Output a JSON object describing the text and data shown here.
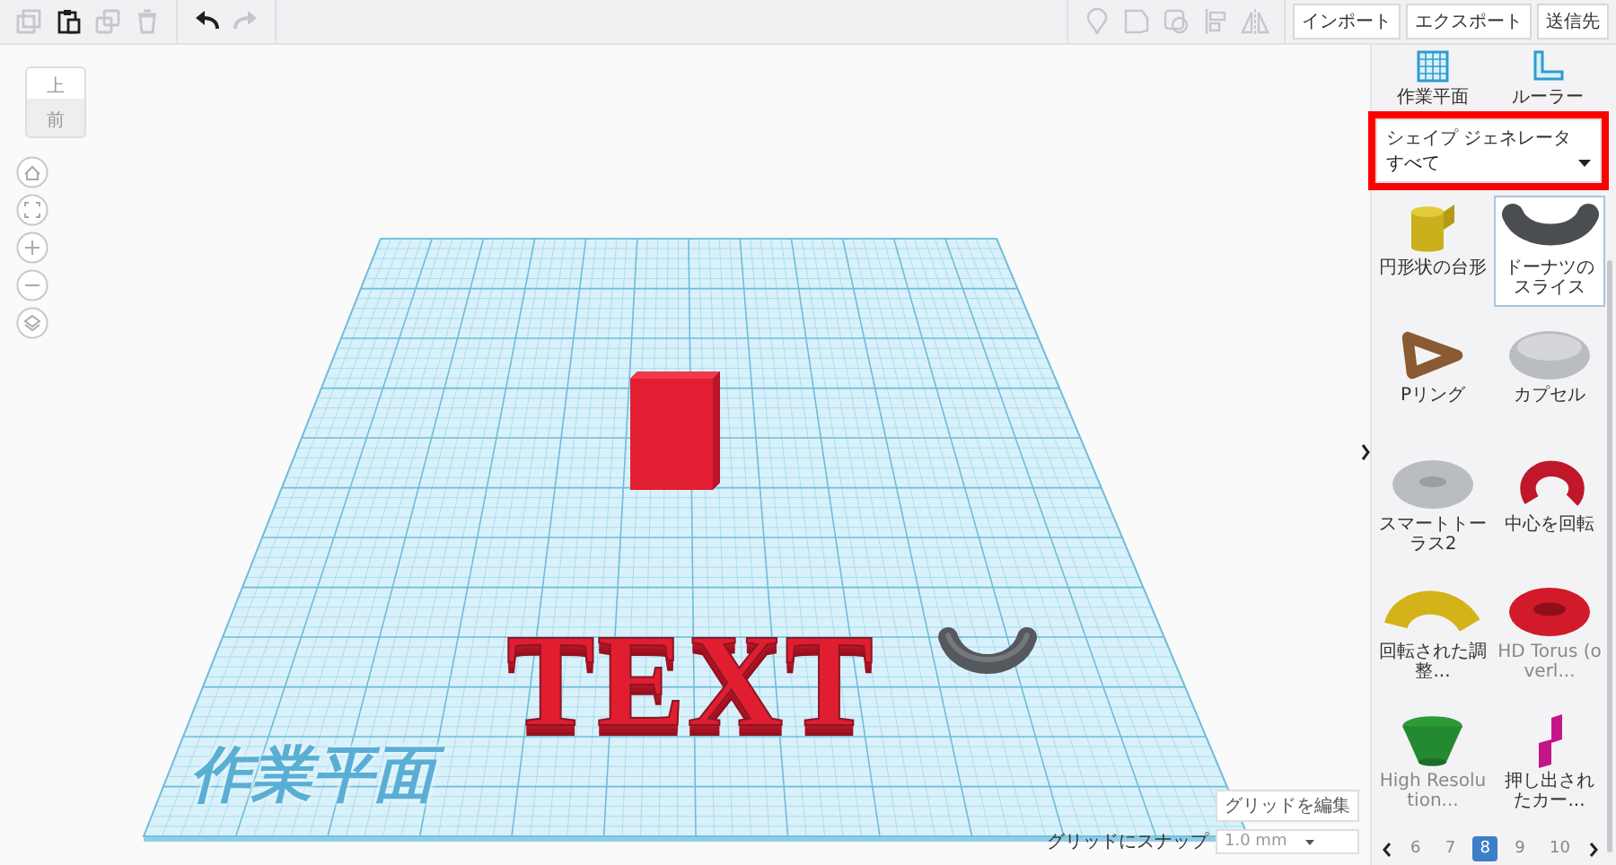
{
  "toolbar": {
    "edit_tools": [
      {
        "disabled": true
      },
      {
        "disabled": false
      },
      {
        "disabled": true
      },
      {
        "disabled": true
      }
    ],
    "history_tools": [
      {
        "disabled": false
      },
      {
        "disabled": true
      }
    ],
    "object_tools": [
      {
        "disabled": true
      },
      {
        "disabled": true
      },
      {
        "disabled": true
      },
      {
        "disabled": true
      },
      {
        "disabled": true
      }
    ],
    "buttons": [
      "インポート",
      "エクスポート",
      "送信先"
    ]
  },
  "view_cube": {
    "top": "上",
    "front": "前"
  },
  "scene": {
    "workplane_label": "作業平面",
    "objects": [
      {
        "kind": "box"
      },
      {
        "kind": "text",
        "text": "TEXT"
      },
      {
        "kind": "arc"
      }
    ]
  },
  "grid_controls": {
    "edit_button": "グリッドを編集",
    "snap_label": "グリッドにスナップ",
    "snap_value": "1.0 mm"
  },
  "panel": {
    "tools": [
      {
        "label": "作業平面"
      },
      {
        "label": "ルーラー"
      }
    ],
    "dropdown": {
      "label": "シェイプ ジェネレータ",
      "value": "すべて"
    },
    "shapes": [
      {
        "label": "円形状の台形",
        "selected": false,
        "muted": false
      },
      {
        "label": "ドーナツのスライス",
        "selected": true,
        "muted": false
      },
      {
        "label": "Pリング",
        "selected": false,
        "muted": false
      },
      {
        "label": "カプセル",
        "selected": false,
        "muted": false
      },
      {
        "label": "スマートトーラス2",
        "selected": false,
        "muted": false
      },
      {
        "label": "中心を回転",
        "selected": false,
        "muted": false
      },
      {
        "label": "回転された調整...",
        "selected": false,
        "muted": false
      },
      {
        "label": "HD Torus (overl...",
        "selected": false,
        "muted": true
      },
      {
        "label": "High Resolution...",
        "selected": false,
        "muted": true
      },
      {
        "label": "押し出されたカー...",
        "selected": false,
        "muted": false
      }
    ],
    "pages": [
      {
        "label": "6",
        "selected": false
      },
      {
        "label": "7",
        "selected": false
      },
      {
        "label": "8",
        "selected": true
      },
      {
        "label": "9",
        "selected": false
      },
      {
        "label": "10",
        "selected": false
      }
    ]
  }
}
